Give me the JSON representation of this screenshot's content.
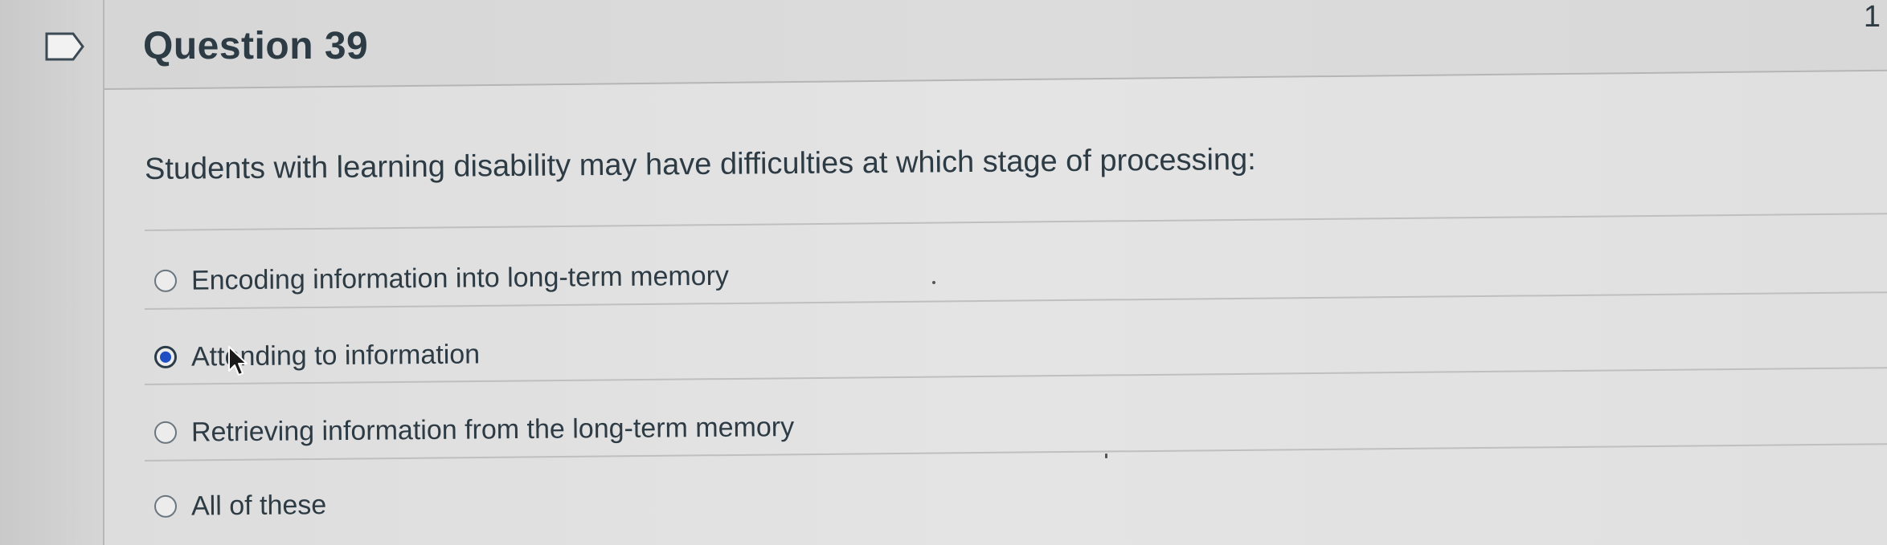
{
  "question": {
    "title": "Question 39",
    "points": "1",
    "text": "Students with learning disability may have difficulties at which stage of processing:",
    "answers": [
      {
        "label": "Encoding information into long-term memory",
        "selected": false
      },
      {
        "label": "Attending to information",
        "selected": true
      },
      {
        "label": "Retrieving information from the long-term memory",
        "selected": false
      },
      {
        "label": "All of these",
        "selected": false
      }
    ]
  },
  "colors": {
    "text": "#2d3b45",
    "radio_selected": "#1f4fc2",
    "border": "#b5b5b5"
  },
  "icons": {
    "flag": "flag-question-icon",
    "cursor": "mouse-pointer-icon"
  }
}
